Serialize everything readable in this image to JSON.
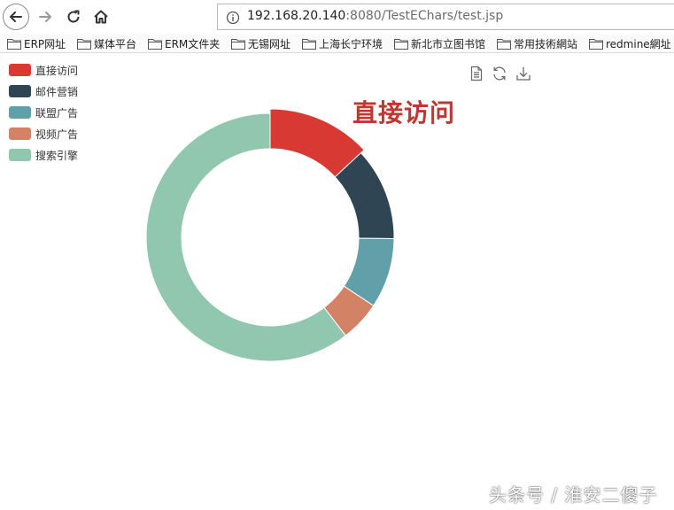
{
  "browser": {
    "url_host": "192.168.20.140",
    "url_rest": ":8080/TestEChars/test.jsp"
  },
  "bookmarks": [
    "ERP网址",
    "媒体平台",
    "ERM文件夹",
    "无锡网址",
    "上海长宁环境",
    "新北市立图书馆",
    "常用技術網站",
    "redmine網址"
  ],
  "chart_data": {
    "type": "pie",
    "subtype": "donut",
    "categories": [
      "直接访问",
      "邮件营销",
      "联盟广告",
      "视频广告",
      "搜索引擎"
    ],
    "values": [
      335,
      310,
      234,
      135,
      1548
    ],
    "colors": [
      "#d83a33",
      "#2f4554",
      "#61a0a8",
      "#d48265",
      "#91c7ae"
    ],
    "highlighted": "直接访问",
    "legend_position": "top-left"
  },
  "hover_label": "直接访问",
  "toolbox": [
    "data-view-icon",
    "restore-icon",
    "save-image-icon"
  ],
  "watermark": "头条号 / 淮安二傻子"
}
